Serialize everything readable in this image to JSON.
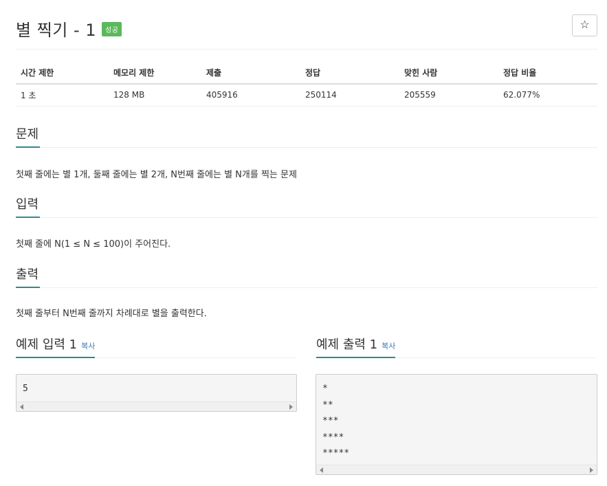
{
  "problem": {
    "title": "별 찍기 - 1",
    "status_badge": "성공",
    "star_icon": "☆"
  },
  "info_table": {
    "headers": [
      "시간 제한",
      "메모리 제한",
      "제출",
      "정답",
      "맞힌 사람",
      "정답 비율"
    ],
    "values": [
      "1 초",
      "128 MB",
      "405916",
      "250114",
      "205559",
      "62.077%"
    ]
  },
  "sections": {
    "description": {
      "heading": "문제",
      "text": "첫째 줄에는 별 1개, 둘째 줄에는 별 2개, N번째 줄에는 별 N개를 찍는 문제"
    },
    "input": {
      "heading": "입력",
      "text": "첫째 줄에 N(1 ≤ N ≤ 100)이 주어진다."
    },
    "output": {
      "heading": "출력",
      "text": "첫째 줄부터 N번째 줄까지 차례대로 별을 출력한다."
    }
  },
  "samples": {
    "input": {
      "heading": "예제 입력 1",
      "copy_label": "복사",
      "lines": [
        "5"
      ]
    },
    "output": {
      "heading": "예제 출력 1",
      "copy_label": "복사",
      "lines": [
        "*",
        "**",
        "***",
        "****",
        "*****"
      ]
    }
  },
  "colors": {
    "badge_success": "#5cb85c",
    "section_underline": "#2c8b8c",
    "link": "#337ab7"
  }
}
